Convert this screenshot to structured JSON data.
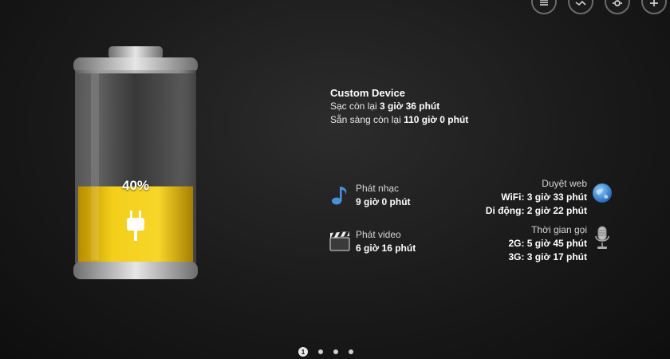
{
  "topbar": {
    "buttons": [
      {
        "icon": "list-icon"
      },
      {
        "icon": "graph-icon"
      },
      {
        "icon": "gear-icon"
      },
      {
        "icon": "plus-icon"
      }
    ]
  },
  "battery": {
    "percent_label": "40%",
    "level": 0.4,
    "fill_color": "#f2c400",
    "charging": true
  },
  "device": {
    "name": "Custom Device",
    "charge_prefix": "Sạc còn lại ",
    "charge_value": "3 giờ 36 phút",
    "standby_prefix": "Sẵn sàng còn lại ",
    "standby_value": "110 giờ 0 phút"
  },
  "stats": {
    "music": {
      "label": "Phát nhạc",
      "value": "9 giờ 0 phút",
      "icon": "music-note-icon"
    },
    "video": {
      "label": "Phát video",
      "value": "6 giờ 16 phút",
      "icon": "clapperboard-icon"
    },
    "web": {
      "label": "Duyệt web",
      "wifi": "WiFi: 3 giờ 33 phút",
      "mobile": "Di động: 2 giờ 22 phút",
      "icon": "globe-icon"
    },
    "call": {
      "label": "Thời gian gọi",
      "g2": "2G: 5 giờ 45 phút",
      "g3": "3G: 3 giờ 17 phút",
      "icon": "microphone-icon"
    }
  },
  "pager": {
    "current": "1",
    "total_pages": 4
  }
}
